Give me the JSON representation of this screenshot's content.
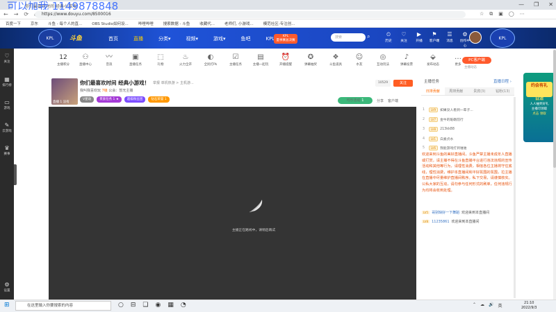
{
  "browser": {
    "tab_title": "你们最喜欢时间 经典小游戏！",
    "overlay_text": "可以加我 1149878848",
    "url": "https://www.douyu.com/8500016",
    "nav_glyphs": [
      "←",
      "→",
      "⟳",
      "⌂"
    ],
    "window_controls": [
      "—",
      "❐",
      "✕"
    ],
    "bookmarks": [
      "百度一下",
      "京东",
      "斗鱼 - 每个人的直...",
      "OBS Studio如何设...",
      "哔哩哔哩",
      "搜索数据 - 斗鱼",
      "收藏代...",
      "老师们, 小游戏...",
      "模范社区-专注创..."
    ]
  },
  "site": {
    "left_badge": "KPL",
    "logo": "斗鱼",
    "nav": [
      "首页",
      "直播",
      "分类▾",
      "视频▾",
      "游戏▾",
      "鱼吧",
      "KPL夏决"
    ],
    "nav_active_index": 1,
    "kpl_badge_top": "KPL",
    "kpl_badge_bottom": "夏季赛总决赛",
    "search_placeholder": "搜索",
    "header_icons": [
      {
        "glyph": "⏲",
        "label": "历史"
      },
      {
        "glyph": "♡",
        "label": "关注"
      },
      {
        "glyph": "▶",
        "label": "开播"
      },
      {
        "glyph": "⚑",
        "label": "客户端"
      },
      {
        "glyph": "☰",
        "label": "消息"
      },
      {
        "glyph": "⚙",
        "label": "创作中心"
      }
    ],
    "right_badge": "KPL"
  },
  "sidebar": [
    {
      "glyph": "♡",
      "label": "关注"
    },
    {
      "glyph": "▦",
      "label": "排行榜"
    },
    {
      "glyph": "▭",
      "label": "游戏"
    },
    {
      "glyph": "✎",
      "label": "云游戏"
    },
    {
      "glyph": "♛",
      "label": "赛事"
    },
    {
      "glyph": "⚙",
      "label": "设置"
    }
  ],
  "category_toolbar": {
    "score": "12",
    "score_label": "主播积分",
    "items": [
      {
        "glyph": "⚇",
        "label": "直播中心"
      },
      {
        "glyph": "〰",
        "label": "音浪"
      },
      {
        "glyph": "▣",
        "label": "直播任务"
      },
      {
        "glyph": "⬚",
        "label": "礼物"
      },
      {
        "glyph": "♨",
        "label": "火力全开"
      },
      {
        "glyph": "◐",
        "label": "全民打Pk"
      },
      {
        "glyph": "☑",
        "label": "主播任务"
      },
      {
        "glyph": "▤",
        "label": "主播一起玩"
      },
      {
        "glyph": "⏰",
        "label": "开播提醒"
      },
      {
        "glyph": "✪",
        "label": "弹幕抽奖"
      },
      {
        "glyph": "❖",
        "label": "斗鱼道具"
      },
      {
        "glyph": "☺",
        "label": "水友"
      },
      {
        "glyph": "◎",
        "label": "互动玩法"
      },
      {
        "glyph": "♪",
        "label": "弹幕投票"
      },
      {
        "glyph": "⬙",
        "label": "发布动态"
      },
      {
        "glyph": "…",
        "label": "更多"
      }
    ],
    "pc_button": "PC客户端",
    "pc_sub": "主播动态"
  },
  "streamer": {
    "thumb_caption": "直播 1 没有",
    "title": "你们最喜欢时间 经典小游戏！",
    "tag": "举报  单机热游 > 主机游...",
    "name": "我叫我喜欢玩",
    "level": "7级",
    "rank_text": "公会：暂无主播",
    "badges": [
      {
        "text": "V星动",
        "color": "#888888"
      },
      {
        "text": "贵族任务 1 ★",
        "color": "#a43ad6"
      },
      {
        "text": "超级粉丝团",
        "color": "#7c4dff"
      },
      {
        "text": "钻石荣誉 1",
        "color": "#ff9800"
      }
    ],
    "fans_count": "10529",
    "follow_label": "关注",
    "report_label": "可乐活动",
    "report_num": "1",
    "share_label": "分享",
    "client_label": "客户端"
  },
  "player": {
    "loading_text": "主播正在路线中，请稍后再试"
  },
  "chat": {
    "top_label": "主播任务",
    "top_right": "直播日程 ›",
    "tabs": [
      "日排贡献",
      "周排贡献",
      "贵宾(3)",
      "钻粉(13)"
    ],
    "active_tab": 0,
    "ranks": [
      {
        "n": "1",
        "lv": "LV9",
        "name": "如果没人看到一辈子..."
      },
      {
        "n": "2",
        "lv": "LV7",
        "name": "金牛的砥砺前行"
      },
      {
        "n": "3",
        "lv": "LV8",
        "name": "213kk88"
      },
      {
        "n": "4",
        "lv": "LV1",
        "name": "白素贞水"
      },
      {
        "n": "5",
        "lv": "LV6",
        "name": "我能游戏打到谁谁"
      }
    ],
    "system_message": "欢迎来到斗鱼的美好直播间，斗鱼严禁主播未成年人直播或打赏，请主播不得在斗鱼直播平台进行违法违规的宣传活动和其他等行为，请理性消费，相信各位主播将守住底线，理性消费，维护本直播间和平好氛围的氛围，拉主播在直播中尽量维护直播间秩序。私下交易，请谨慎核实。公私大家的互动，请勿参与任何形式的刷单，任何违规行为均将会收到处理。",
    "lines": [
      {
        "lv": "LV5",
        "name": "哥别缺好一下舞蹈",
        "text": "欢迎来到本直播间"
      },
      {
        "lv": "LV8",
        "name": "11235861",
        "text": "欢迎来到本直播间"
      }
    ]
  },
  "right_ad": {
    "gift": "约会有礼",
    "line1": "今日抽奖活动",
    "line2": "参与入口",
    "line3": "日活",
    "line4": "人人抽奖好礼",
    "line5": "主播可领取",
    "line6": "点击 领取"
  },
  "taskbar": {
    "start": "⊞",
    "search_placeholder": "在这里输入你要搜索的内容",
    "icons": [
      "○",
      "⊟",
      "❑",
      "◉",
      "▦",
      "◔"
    ],
    "tray": [
      "⌃",
      "☁",
      "🔊",
      "英"
    ],
    "time": "21:10",
    "date": "2022/9/3"
  }
}
